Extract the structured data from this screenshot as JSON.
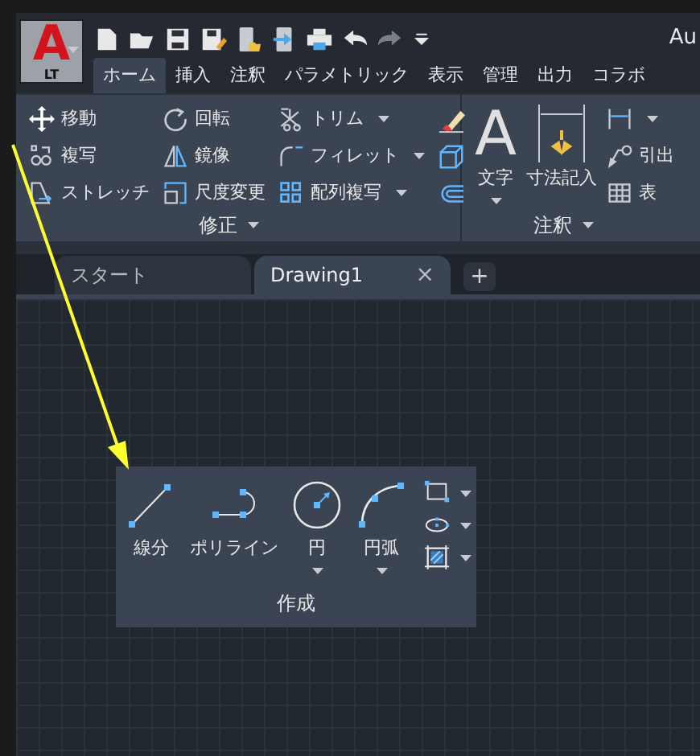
{
  "app_button": {
    "glyph": "A",
    "label": "LT"
  },
  "title": "Au",
  "ribbon_tabs": [
    {
      "label": "ホーム",
      "selected": true
    },
    {
      "label": "挿入",
      "selected": false
    },
    {
      "label": "注釈",
      "selected": false
    },
    {
      "label": "パラメトリック",
      "selected": false
    },
    {
      "label": "表示",
      "selected": false
    },
    {
      "label": "管理",
      "selected": false
    },
    {
      "label": "出力",
      "selected": false
    },
    {
      "label": "コラボ",
      "selected": false
    }
  ],
  "modify_panel": {
    "title": "修正",
    "columns": [
      [
        {
          "label": "移動",
          "dropdown": false
        },
        {
          "label": "複写",
          "dropdown": false
        },
        {
          "label": "ストレッチ",
          "dropdown": false
        }
      ],
      [
        {
          "label": "回転",
          "dropdown": false
        },
        {
          "label": "鏡像",
          "dropdown": false
        },
        {
          "label": "尺度変更",
          "dropdown": false
        }
      ],
      [
        {
          "label": "トリム",
          "dropdown": true
        },
        {
          "label": "フィレット",
          "dropdown": true
        },
        {
          "label": "配列複写",
          "dropdown": true
        }
      ]
    ]
  },
  "annotation_panel": {
    "title": "注釈",
    "large_tools": [
      {
        "glyph": "A",
        "label": "文字",
        "dropdown": true
      },
      {
        "label": "寸法記入",
        "dropdown": false
      }
    ],
    "small_tools": [
      {
        "dropdown": true
      },
      {
        "label": "引出",
        "dropdown": false
      },
      {
        "label": "表",
        "dropdown": false
      }
    ]
  },
  "file_tabs": [
    {
      "label": "スタート",
      "selected": false
    },
    {
      "label": "Drawing1",
      "selected": true,
      "close": "×"
    }
  ],
  "new_tab": "+",
  "floating_panel": {
    "title": "作成",
    "tools": [
      {
        "label": "線分",
        "dropdown": false
      },
      {
        "label": "ポリライン",
        "dropdown": false
      },
      {
        "label": "円",
        "dropdown": true
      },
      {
        "label": "円弧",
        "dropdown": true
      }
    ],
    "small_tools": [
      {
        "dropdown": true
      },
      {
        "dropdown": true
      },
      {
        "dropdown": true
      }
    ]
  }
}
